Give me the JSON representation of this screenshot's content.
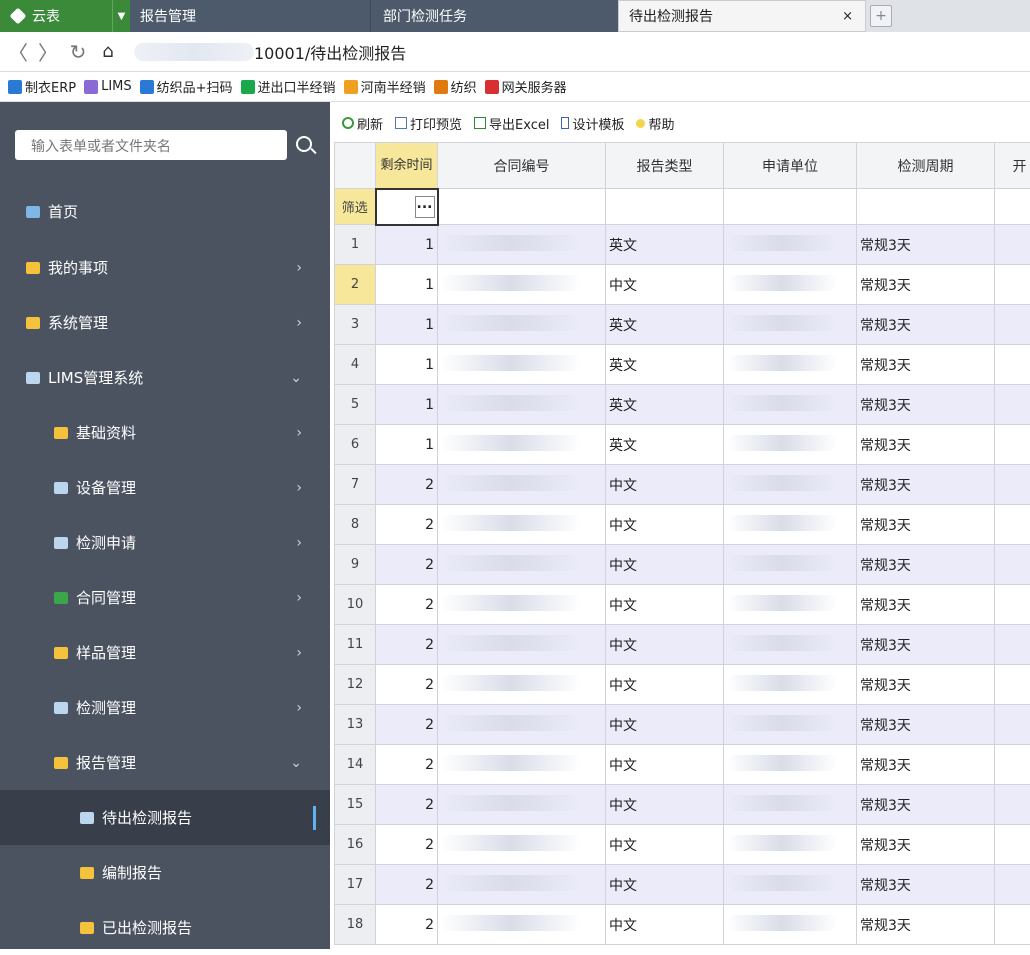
{
  "tabs": {
    "brand": "云表",
    "tab1": "报告管理",
    "tab2": "部门检测任务",
    "tab3": "待出检测报告",
    "close": "×",
    "new": "+"
  },
  "address": {
    "back": "〈",
    "forward": "〉",
    "refresh": "↻",
    "home": "⌂",
    "url_suffix": "10001/待出检测报告"
  },
  "bookmarks": [
    {
      "label": "制衣ERP",
      "color": "#2a7ad5"
    },
    {
      "label": "LIMS",
      "color": "#8a6bd6"
    },
    {
      "label": "纺织品+扫码",
      "color": "#2a7ad5"
    },
    {
      "label": "进出口半经销",
      "color": "#1aa84a"
    },
    {
      "label": "河南半经销",
      "color": "#f0a020"
    },
    {
      "label": "纺织",
      "color": "#e07a10"
    },
    {
      "label": "网关服务器",
      "color": "#d83030"
    }
  ],
  "sidebar": {
    "search_placeholder": "输入表单或者文件夹名",
    "items": [
      {
        "label": "首页",
        "icon": "home-icon"
      },
      {
        "label": "我的事项",
        "icon": "folder-icon"
      },
      {
        "label": "系统管理",
        "icon": "folder-icon"
      },
      {
        "label": "LIMS管理系统",
        "icon": "globe-icon"
      },
      {
        "label": "基础资料",
        "icon": "document-icon"
      },
      {
        "label": "设备管理",
        "icon": "equipment-icon"
      },
      {
        "label": "检测申请",
        "icon": "grid-icon"
      },
      {
        "label": "合同管理",
        "icon": "contract-icon"
      },
      {
        "label": "样品管理",
        "icon": "tag-icon"
      },
      {
        "label": "检测管理",
        "icon": "chart-icon"
      },
      {
        "label": "报告管理",
        "icon": "report-icon"
      },
      {
        "label": "待出检测报告",
        "icon": "list-icon"
      },
      {
        "label": "编制报告",
        "icon": "clipboard-icon"
      },
      {
        "label": "已出检测报告",
        "icon": "document-icon"
      }
    ]
  },
  "toolbar": {
    "refresh": "刷新",
    "print_preview": "打印预览",
    "export_excel": "导出Excel",
    "design_template": "设计模板",
    "help": "帮助"
  },
  "grid": {
    "headers": {
      "remaining": "剩余时间",
      "contract_no": "合同编号",
      "report_type": "报告类型",
      "applicant": "申请单位",
      "cycle": "检测周期",
      "next": "开"
    },
    "filter_label": "筛选",
    "filter_button": "...",
    "rows": [
      {
        "no": "1",
        "remain": "1",
        "type": "英文",
        "cycle": "常规3天"
      },
      {
        "no": "2",
        "remain": "1",
        "type": "中文",
        "cycle": "常规3天"
      },
      {
        "no": "3",
        "remain": "1",
        "type": "英文",
        "cycle": "常规3天"
      },
      {
        "no": "4",
        "remain": "1",
        "type": "英文",
        "cycle": "常规3天"
      },
      {
        "no": "5",
        "remain": "1",
        "type": "英文",
        "cycle": "常规3天"
      },
      {
        "no": "6",
        "remain": "1",
        "type": "英文",
        "cycle": "常规3天"
      },
      {
        "no": "7",
        "remain": "2",
        "type": "中文",
        "cycle": "常规3天"
      },
      {
        "no": "8",
        "remain": "2",
        "type": "中文",
        "cycle": "常规3天"
      },
      {
        "no": "9",
        "remain": "2",
        "type": "中文",
        "cycle": "常规3天"
      },
      {
        "no": "10",
        "remain": "2",
        "type": "中文",
        "cycle": "常规3天"
      },
      {
        "no": "11",
        "remain": "2",
        "type": "中文",
        "cycle": "常规3天"
      },
      {
        "no": "12",
        "remain": "2",
        "type": "中文",
        "cycle": "常规3天"
      },
      {
        "no": "13",
        "remain": "2",
        "type": "中文",
        "cycle": "常规3天"
      },
      {
        "no": "14",
        "remain": "2",
        "type": "中文",
        "cycle": "常规3天"
      },
      {
        "no": "15",
        "remain": "2",
        "type": "中文",
        "cycle": "常规3天"
      },
      {
        "no": "16",
        "remain": "2",
        "type": "中文",
        "cycle": "常规3天"
      },
      {
        "no": "17",
        "remain": "2",
        "type": "中文",
        "cycle": "常规3天"
      },
      {
        "no": "18",
        "remain": "2",
        "type": "中文",
        "cycle": "常规3天"
      }
    ]
  }
}
